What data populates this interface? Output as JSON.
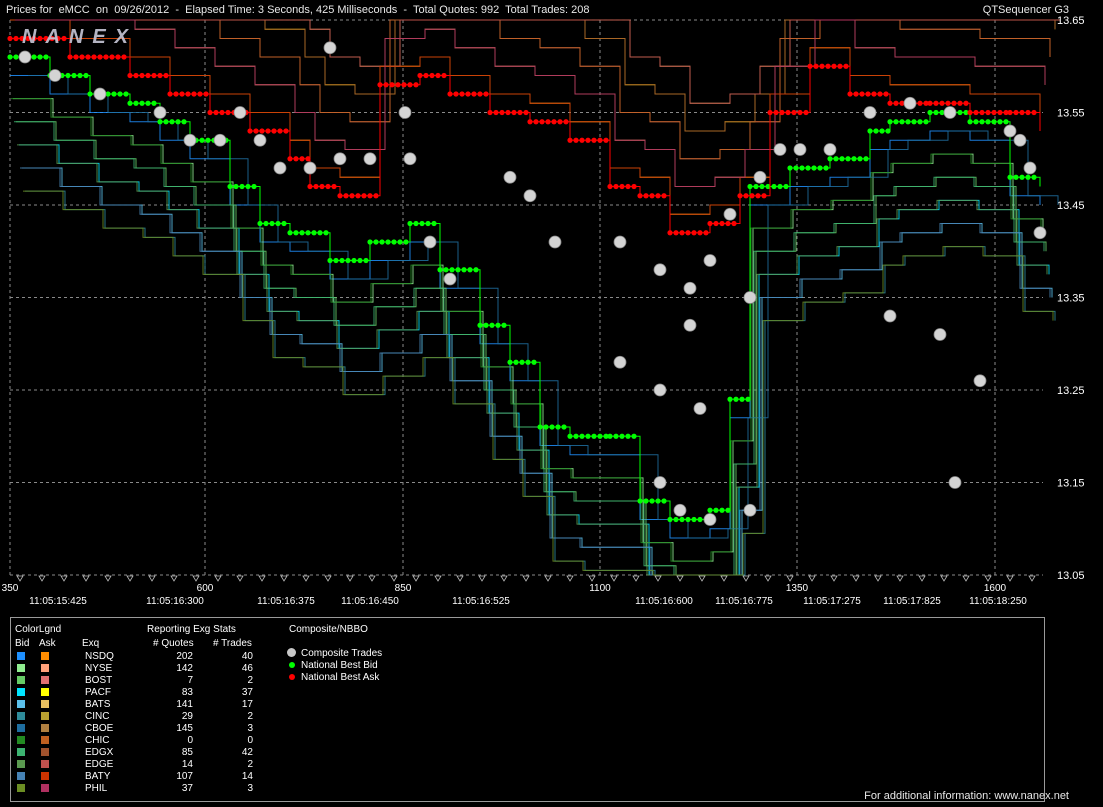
{
  "header": {
    "title": "Prices for  eMCC  on  09/26/2012  -  Elapsed Time: 3 Seconds, 425 Milliseconds  -  Total Quotes: 992  Total Trades: 208",
    "app": "QTSequencer G3",
    "logo": "NANEX"
  },
  "chart_data": {
    "type": "line",
    "y_ticks": [
      "13.65",
      "13.55",
      "13.45",
      "13.35",
      "13.25",
      "13.15",
      "13.05"
    ],
    "ylim": [
      13.05,
      13.65
    ],
    "x_seq_ticks": [
      "350",
      "600",
      "850",
      "1100",
      "1350",
      "1600"
    ],
    "x_time_ticks": [
      "11:05:15:425",
      "11:05:16:300",
      "11:05:16:375",
      "11:05:16:450",
      "11:05:16:525",
      "11:05:16:600",
      "11:05:16:775",
      "11:05:17:275",
      "11:05:17:825",
      "11:05:18:250"
    ],
    "grid": true,
    "series": [
      {
        "name": "National Best Bid",
        "color": "#00ff00",
        "points": [
          [
            0,
            13.61
          ],
          [
            40,
            13.59
          ],
          [
            80,
            13.57
          ],
          [
            120,
            13.56
          ],
          [
            150,
            13.54
          ],
          [
            180,
            13.52
          ],
          [
            220,
            13.47
          ],
          [
            250,
            13.43
          ],
          [
            280,
            13.42
          ],
          [
            320,
            13.39
          ],
          [
            360,
            13.41
          ],
          [
            400,
            13.43
          ],
          [
            430,
            13.38
          ],
          [
            470,
            13.32
          ],
          [
            500,
            13.28
          ],
          [
            530,
            13.21
          ],
          [
            560,
            13.2
          ],
          [
            600,
            13.2
          ],
          [
            630,
            13.13
          ],
          [
            660,
            13.11
          ],
          [
            700,
            13.12
          ],
          [
            720,
            13.24
          ],
          [
            740,
            13.47
          ],
          [
            780,
            13.49
          ],
          [
            820,
            13.5
          ],
          [
            860,
            13.53
          ],
          [
            880,
            13.54
          ],
          [
            920,
            13.55
          ],
          [
            960,
            13.54
          ],
          [
            1000,
            13.48
          ],
          [
            1030,
            13.47
          ]
        ]
      },
      {
        "name": "National Best Ask",
        "color": "#ff0000",
        "points": [
          [
            0,
            13.63
          ],
          [
            60,
            13.61
          ],
          [
            120,
            13.59
          ],
          [
            160,
            13.57
          ],
          [
            200,
            13.55
          ],
          [
            240,
            13.53
          ],
          [
            280,
            13.5
          ],
          [
            300,
            13.47
          ],
          [
            330,
            13.46
          ],
          [
            370,
            13.58
          ],
          [
            410,
            13.59
          ],
          [
            440,
            13.57
          ],
          [
            480,
            13.55
          ],
          [
            520,
            13.54
          ],
          [
            560,
            13.52
          ],
          [
            600,
            13.47
          ],
          [
            630,
            13.46
          ],
          [
            660,
            13.42
          ],
          [
            700,
            13.43
          ],
          [
            730,
            13.46
          ],
          [
            760,
            13.55
          ],
          [
            800,
            13.6
          ],
          [
            840,
            13.57
          ],
          [
            880,
            13.56
          ],
          [
            920,
            13.56
          ],
          [
            960,
            13.55
          ],
          [
            1000,
            13.55
          ],
          [
            1030,
            13.53
          ]
        ]
      },
      {
        "name": "Composite Trades",
        "color": "#d0d0d0",
        "points": [
          [
            15,
            13.61
          ],
          [
            45,
            13.59
          ],
          [
            90,
            13.57
          ],
          [
            150,
            13.55
          ],
          [
            180,
            13.52
          ],
          [
            210,
            13.52
          ],
          [
            230,
            13.55
          ],
          [
            250,
            13.52
          ],
          [
            270,
            13.49
          ],
          [
            300,
            13.49
          ],
          [
            330,
            13.5
          ],
          [
            360,
            13.5
          ],
          [
            395,
            13.55
          ],
          [
            400,
            13.5
          ],
          [
            420,
            13.41
          ],
          [
            440,
            13.37
          ],
          [
            500,
            13.48
          ],
          [
            520,
            13.46
          ],
          [
            545,
            13.41
          ],
          [
            610,
            13.41
          ],
          [
            610,
            13.28
          ],
          [
            650,
            13.38
          ],
          [
            680,
            13.36
          ],
          [
            680,
            13.32
          ],
          [
            690,
            13.23
          ],
          [
            700,
            13.39
          ],
          [
            720,
            13.44
          ],
          [
            750,
            13.48
          ],
          [
            770,
            13.51
          ],
          [
            790,
            13.51
          ],
          [
            820,
            13.51
          ],
          [
            860,
            13.55
          ],
          [
            900,
            13.56
          ],
          [
            940,
            13.55
          ],
          [
            970,
            13.26
          ],
          [
            1000,
            13.53
          ],
          [
            1010,
            13.52
          ],
          [
            1020,
            13.49
          ],
          [
            1030,
            13.42
          ],
          [
            880,
            13.33
          ],
          [
            930,
            13.31
          ],
          [
            945,
            13.15
          ],
          [
            740,
            13.35
          ],
          [
            650,
            13.25
          ],
          [
            650,
            13.15
          ],
          [
            670,
            13.12
          ],
          [
            700,
            13.11
          ],
          [
            740,
            13.12
          ],
          [
            320,
            13.62
          ]
        ]
      }
    ]
  },
  "legend": {
    "color_title": "ColorLgnd",
    "bid_label": "Bid",
    "ask_label": "Ask",
    "exq_label": "Exq",
    "stats_title": "Reporting Exg Stats",
    "quotes_label": "# Quotes",
    "trades_label": "# Trades",
    "composite_title": "Composite/NBBO",
    "exchanges": [
      {
        "name": "NSDQ",
        "quotes": "202",
        "trades": "40",
        "bid": "#1e90ff",
        "ask": "#ff8c00"
      },
      {
        "name": "NYSE",
        "quotes": "142",
        "trades": "46",
        "bid": "#90ee90",
        "ask": "#ffa07a"
      },
      {
        "name": "BOST",
        "quotes": "7",
        "trades": "2",
        "bid": "#66cc66",
        "ask": "#e07070"
      },
      {
        "name": "PACF",
        "quotes": "83",
        "trades": "37",
        "bid": "#00e5ff",
        "ask": "#ffff00"
      },
      {
        "name": "BATS",
        "quotes": "141",
        "trades": "17",
        "bid": "#5bc0eb",
        "ask": "#e8c060"
      },
      {
        "name": "CINC",
        "quotes": "29",
        "trades": "2",
        "bid": "#2e8b9a",
        "ask": "#b8a030"
      },
      {
        "name": "CBOE",
        "quotes": "145",
        "trades": "3",
        "bid": "#1e6ea0",
        "ask": "#b08040"
      },
      {
        "name": "CHIC",
        "quotes": "0",
        "trades": "0",
        "bid": "#228b22",
        "ask": "#c06020"
      },
      {
        "name": "EDGX",
        "quotes": "85",
        "trades": "42",
        "bid": "#3cb371",
        "ask": "#a0522d"
      },
      {
        "name": "EDGE",
        "quotes": "14",
        "trades": "2",
        "bid": "#5a9a50",
        "ask": "#c0504d"
      },
      {
        "name": "BATY",
        "quotes": "107",
        "trades": "14",
        "bid": "#4682b4",
        "ask": "#cc3300"
      },
      {
        "name": "PHIL",
        "quotes": "37",
        "trades": "3",
        "bid": "#6b8e23",
        "ask": "#b03060"
      }
    ],
    "composite_items": [
      {
        "name": "Composite Trades",
        "color": "#c8c8c8"
      },
      {
        "name": "National Best Bid",
        "color": "#00ff00"
      },
      {
        "name": "National Best Ask",
        "color": "#ff0000"
      }
    ]
  },
  "footer": {
    "info": "For additional information: www.nanex.net"
  }
}
